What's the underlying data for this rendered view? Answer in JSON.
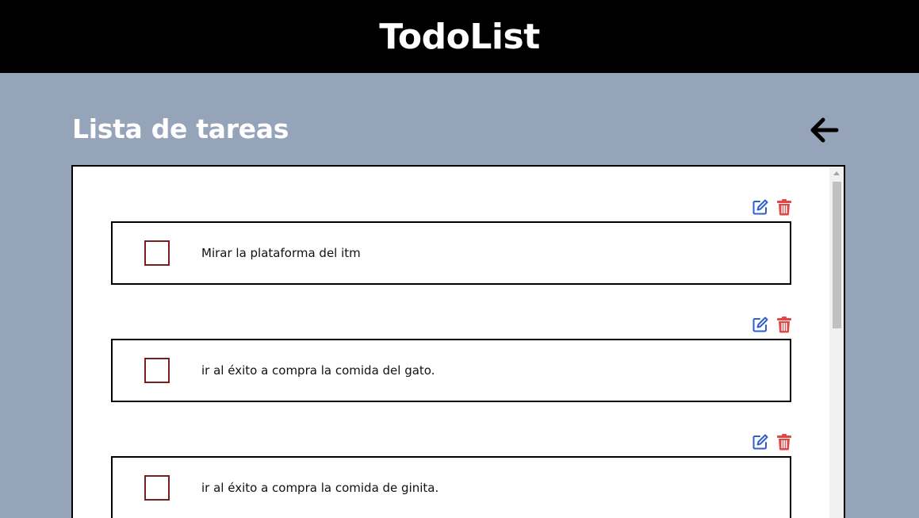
{
  "header": {
    "title": "TodoList"
  },
  "section": {
    "title": "Lista de tareas",
    "back_icon": "arrow-left-icon"
  },
  "icons": {
    "edit": "edit-icon",
    "delete": "trash-icon"
  },
  "colors": {
    "edit": "#2f5fc9",
    "delete": "#e04848",
    "checkbox_border": "#7a1f1f",
    "background": "#95a4b9"
  },
  "tasks": [
    {
      "text": "Mirar la plataforma del itm",
      "done": false
    },
    {
      "text": "ir al éxito a compra la comida del gato.",
      "done": false
    },
    {
      "text": "ir al éxito a compra la comida de ginita.",
      "done": false
    }
  ]
}
